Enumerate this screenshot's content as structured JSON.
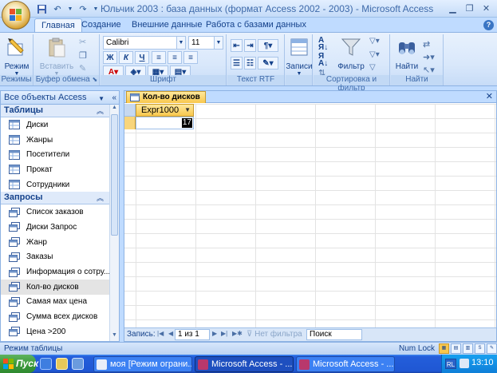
{
  "window": {
    "title": "Юльчик 2003 : база данных (формат Access 2002 - 2003) - Microsoft Access"
  },
  "ribbon": {
    "tabs": [
      "Главная",
      "Создание",
      "Внешние данные",
      "Работа с базами данных"
    ],
    "active_tab": 0,
    "groups": {
      "views": "Режимы",
      "clipboard": "Буфер обмена",
      "font": "Шрифт",
      "rich_text": "Текст RTF",
      "records": "",
      "sort_filter": "Сортировка и фильтр",
      "find": "Найти"
    },
    "buttons": {
      "view": "Режим",
      "paste": "Вставить",
      "records": "Записи",
      "filter": "Фильтр",
      "find": "Найти"
    },
    "font_name": "Calibri",
    "font_size": "11",
    "format_buttons": [
      "Ж",
      "К",
      "Ч"
    ]
  },
  "nav": {
    "header": "Все объекты Access",
    "sections": [
      {
        "title": "Таблицы",
        "items": [
          "Диски",
          "Жанры",
          "Посетители",
          "Прокат",
          "Сотрудники"
        ]
      },
      {
        "title": "Запросы",
        "items": [
          "Список заказов",
          "Диски Запрос",
          "Жанр",
          "Заказы",
          "Информация о сотру...",
          "Кол-во дисков",
          "Самая мах цена",
          "Сумма всех дисков",
          "Цена >200"
        ]
      }
    ],
    "selected_item": "Кол-во дисков"
  },
  "document": {
    "tab_title": "Кол-во дисков",
    "column_header": "Expr1000",
    "cell_value": "17",
    "record_nav": {
      "label": "Запись:",
      "position": "1 из 1",
      "filter": "Нет фильтра",
      "search": "Поиск"
    }
  },
  "status": {
    "mode": "Режим таблицы",
    "numlock": "Num Lock"
  },
  "taskbar": {
    "start": "Пуск",
    "tasks": [
      "моя [Режим ограни...",
      "Microsoft Access - ...",
      "Microsoft Access - ..."
    ],
    "active_task": 1,
    "lang": "RL",
    "clock": "13:10"
  },
  "colors": {
    "ribbon_bg": "#d9e8fb",
    "accent_tab": "#f8c74d",
    "taskbar": "#245edb",
    "start_green": "#3c9a3c"
  }
}
